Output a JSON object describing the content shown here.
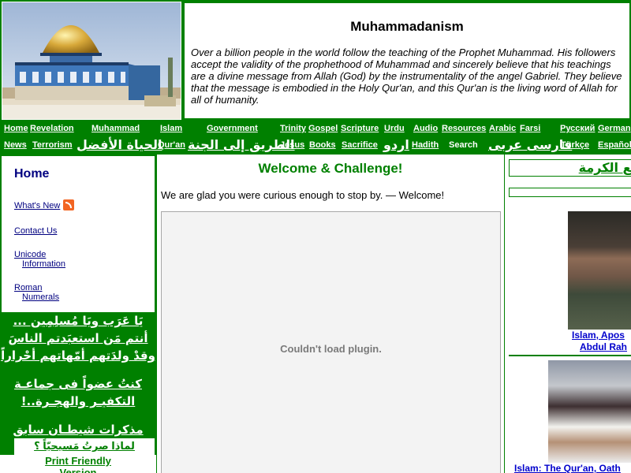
{
  "header": {
    "photo_alt": "Dome of the Rock",
    "site_title": "Muhammadanism",
    "intro": "Over a billion people in the world follow the teaching of the Prophet Muhammad. His followers accept the validity of the prophethood of Muhammad and sincerely believe that his teachings are a divine message from Allah (God) by the instrumentality of the angel Gabriel. They believe that the message is embodied in the Holy Qur'an, and this Qur'an is the living word of Allah for all of humanity."
  },
  "nav": {
    "row1": [
      "Home",
      "Revelation",
      "Muhammad",
      "Islam",
      "Government",
      "Trinity",
      "Gospel",
      "Scripture",
      "Urdu",
      "Audio",
      "Resources",
      "Arabic",
      "Farsi",
      "Русский",
      "German"
    ],
    "row2": [
      "News",
      "Terrorism",
      "الحياة الأفضل",
      "Qur'an",
      "الطريق إلى الجنة",
      "Jesus",
      "Books",
      "Sacrifice",
      "اردو",
      "Hadith",
      "Search",
      "فارسی عربی",
      "Türkçe",
      "Español"
    ]
  },
  "sidebar": {
    "title": "Home",
    "links": {
      "whats_new": "What's New",
      "contact": "Contact Us",
      "unicode_1": "Unicode",
      "unicode_2": "Information",
      "roman_1": "Roman",
      "roman_2": "Numerals"
    },
    "promo1": [
      "يَا عَرَب ويَا مُسلِمِين ...",
      "أنتم مَن استعبَدتم الناسَ",
      "وقدْ ولدَتهم أمّهاتهم أحْراراً"
    ],
    "promo2": [
      "كنتُ عضواً فى جماعـة",
      "التكفيـر والهجـرة..!"
    ],
    "promo3": [
      "مذكرات شيطـان سابق"
    ],
    "promo4": [
      "لماذا صرتُ مَسيحيّاً ؟"
    ],
    "print_1": "Print Friendly",
    "print_2": "Version"
  },
  "main": {
    "title": "Welcome & Challenge!",
    "text": "We are glad you were curious enough to stop by. —  Welcome!",
    "plugin_message": "Couldn't load plugin."
  },
  "right": {
    "title": "ـع الكرمة",
    "caption1a": "Islam, Apos",
    "caption1b": "Abdul Rah",
    "caption2": "Islam: The Qur'an, Oath"
  },
  "colors": {
    "green": "#008000",
    "navy": "#000080",
    "link_blue": "#0000cc"
  }
}
